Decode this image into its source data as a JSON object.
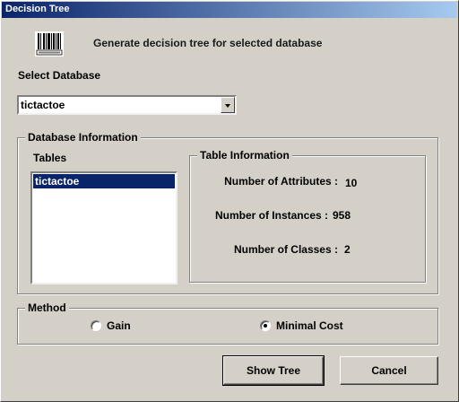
{
  "window": {
    "title": "Decision Tree"
  },
  "header": {
    "icon": "barcode-icon",
    "text": "Generate decision tree for selected database"
  },
  "select_database": {
    "label": "Select Database",
    "value": "tictactoe"
  },
  "database_info": {
    "group_title": "Database Information",
    "tables_label": "Tables",
    "tables": [
      "tictactoe"
    ],
    "selected_table": "tictactoe"
  },
  "table_info": {
    "group_title": "Table Information",
    "attributes_label": "Number of Attributes :",
    "attributes_value": "10",
    "instances_label": "Number of Instances :",
    "instances_value": "958",
    "classes_label": "Number of Classes :",
    "classes_value": "2"
  },
  "method": {
    "group_title": "Method",
    "options": [
      {
        "label": "Gain",
        "selected": false
      },
      {
        "label": "Minimal Cost",
        "selected": true
      }
    ]
  },
  "buttons": {
    "show_tree": "Show Tree",
    "cancel": "Cancel"
  },
  "colors": {
    "titlebar_start": "#0a246a",
    "titlebar_end": "#a6caf0",
    "face": "#d4d0c8",
    "selection": "#0a246a"
  }
}
